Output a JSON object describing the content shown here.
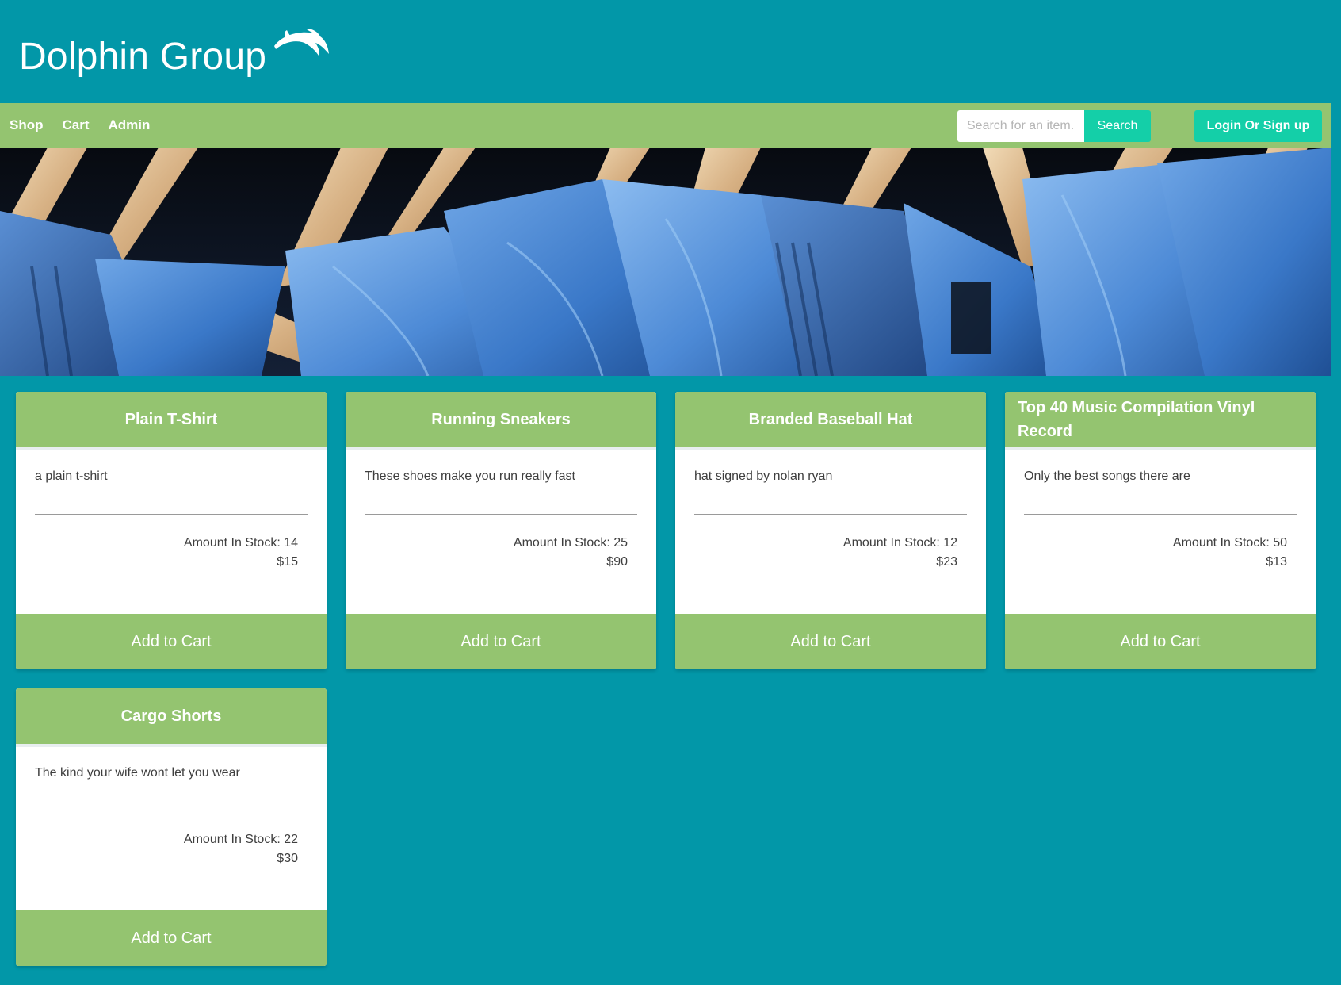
{
  "brand": {
    "name": "Dolphin Group",
    "logo_icon": "dolphin-icon"
  },
  "nav": {
    "links": [
      "Shop",
      "Cart",
      "Admin"
    ]
  },
  "search": {
    "placeholder": "Search for an item...",
    "button_label": "Search"
  },
  "auth": {
    "login_label": "Login Or Sign up"
  },
  "colors": {
    "page_background": "#0297a8",
    "accent_green": "#94c470",
    "button_teal": "#14cfa8"
  },
  "products": [
    {
      "title": "Plain T-Shirt",
      "description": "a plain t-shirt",
      "stock": "Amount In Stock: 14",
      "price": "$15",
      "button": "Add to Cart"
    },
    {
      "title": "Running Sneakers",
      "description": "These shoes make you run really fast",
      "stock": "Amount In Stock: 25",
      "price": "$90",
      "button": "Add to Cart"
    },
    {
      "title": "Branded Baseball Hat",
      "description": "hat signed by nolan ryan",
      "stock": "Amount In Stock: 12",
      "price": "$23",
      "button": "Add to Cart"
    },
    {
      "title": "Top 40 Music Compilation Vinyl Record",
      "description": "Only the best songs there are",
      "stock": "Amount In Stock: 50",
      "price": "$13",
      "button": "Add to Cart"
    },
    {
      "title": "Cargo Shorts",
      "description": "The kind your wife wont let you wear",
      "stock": "Amount In Stock: 22",
      "price": "$30",
      "button": "Add to Cart"
    }
  ]
}
